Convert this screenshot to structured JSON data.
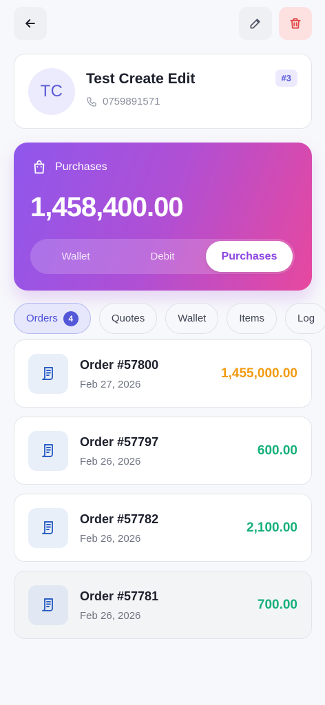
{
  "topbar": {
    "back_icon": "arrow-left-icon",
    "edit_icon": "pencil-icon",
    "delete_icon": "trash-icon"
  },
  "contact": {
    "initials": "TC",
    "name": "Test Create Edit",
    "phone": "0759891571",
    "tag": "#3"
  },
  "balance": {
    "label": "Purchases",
    "amount": "1,458,400.00",
    "segments": [
      {
        "label": "Wallet",
        "active": false
      },
      {
        "label": "Debit",
        "active": false
      },
      {
        "label": "Purchases",
        "active": true
      }
    ]
  },
  "tabs": [
    {
      "label": "Orders",
      "count": "4",
      "active": true
    },
    {
      "label": "Quotes",
      "active": false
    },
    {
      "label": "Wallet",
      "active": false
    },
    {
      "label": "Items",
      "active": false
    },
    {
      "label": "Log",
      "active": false
    }
  ],
  "orders": [
    {
      "title": "Order #57800",
      "date": "Feb 27, 2026",
      "amount": "1,455,000.00",
      "color": "#f29b12"
    },
    {
      "title": "Order #57797",
      "date": "Feb 26, 2026",
      "amount": "600.00",
      "color": "#16b07a"
    },
    {
      "title": "Order #57782",
      "date": "Feb 26, 2026",
      "amount": "2,100.00",
      "color": "#16b07a"
    },
    {
      "title": "Order #57781",
      "date": "Feb 26, 2026",
      "amount": "700.00",
      "color": "#16b07a"
    }
  ],
  "colors": {
    "accent": "#5457d8",
    "delete": "#e04848",
    "pending_amount": "#f29b12",
    "paid_amount": "#16b07a"
  }
}
